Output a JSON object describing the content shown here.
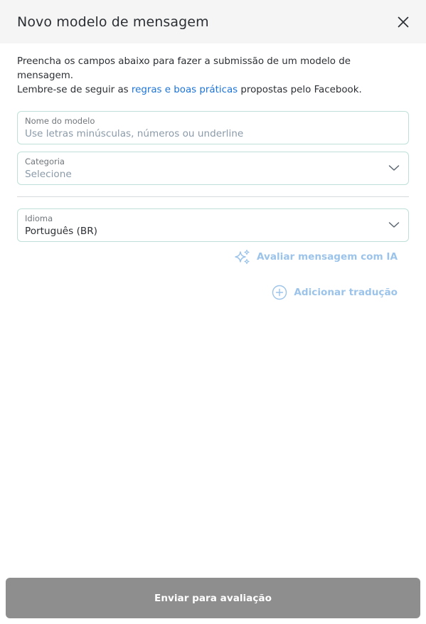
{
  "header": {
    "title": "Novo modelo de mensagem",
    "close_icon": "close-icon"
  },
  "intro": {
    "line1": "Preencha os campos abaixo para fazer a submissão de um modelo de mensagem.",
    "line2_prefix": "Lembre-se de seguir as ",
    "link_text": "regras e boas práticas",
    "line2_suffix": " propostas pelo Facebook."
  },
  "form": {
    "model_name": {
      "label": "Nome do modelo",
      "value": "",
      "placeholder": "Use letras minúsculas, números ou underline"
    },
    "category": {
      "label": "Categoria",
      "selected": "Selecione",
      "icon": "chevron-down-icon"
    },
    "language": {
      "label": "Idioma",
      "selected": "Português (BR)",
      "icon": "chevron-down-icon"
    }
  },
  "actions": {
    "ai_review": {
      "label": "Avaliar mensagem com IA",
      "icon": "sparkles-icon"
    },
    "add_translation": {
      "label": "Adicionar tradução",
      "icon": "plus-circle-icon"
    }
  },
  "footer": {
    "submit_label": "Enviar para avaliação"
  },
  "colors": {
    "link": "#1a73d9",
    "action_text": "#9cc4ea",
    "field_border": "#bfe0d9",
    "submit_bg": "#8e8e8e",
    "header_bg": "#f5f5f5"
  }
}
